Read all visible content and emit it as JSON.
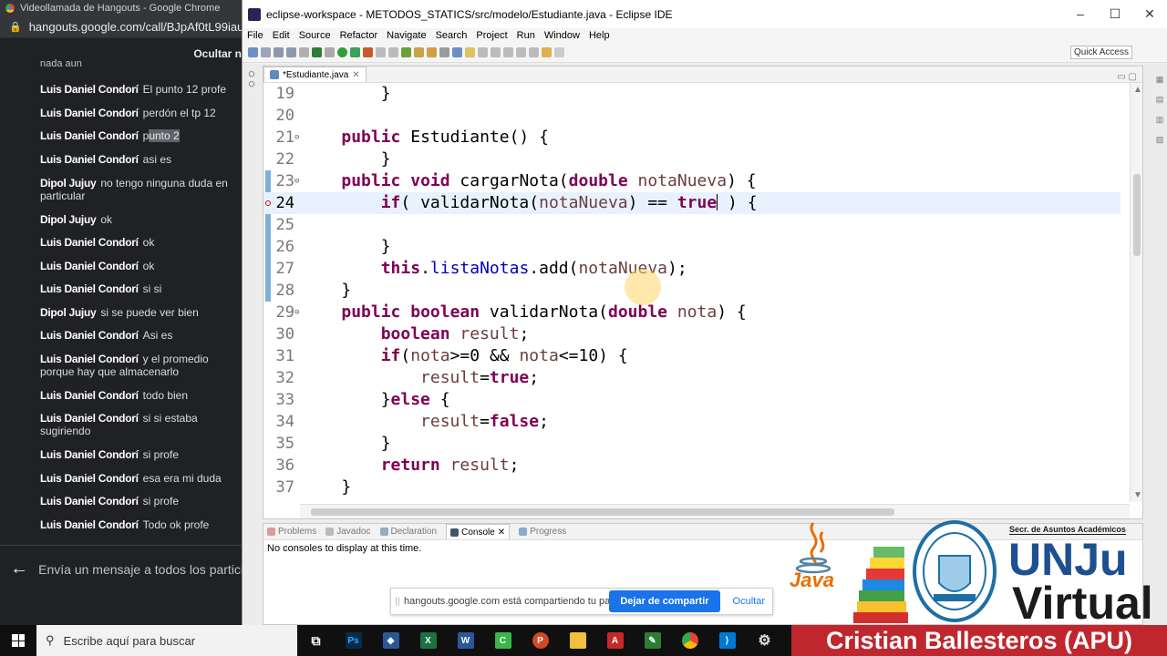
{
  "chrome": {
    "window_title": "Videollamada de Hangouts - Google Chrome",
    "url": "hangouts.google.com/call/BJpAf0tL99iauoPOj"
  },
  "chat": {
    "hide_button": "Ocultar n",
    "cut_text": "nada aun",
    "messages": [
      {
        "author": "Luis Daniel Condorí",
        "text": "El punto 12 profe"
      },
      {
        "author": "Luis Daniel Condorí",
        "text": "perdón el tp 12"
      },
      {
        "author": "Luis Daniel Condorí",
        "text_a": "p",
        "text_hl": "unto 2"
      },
      {
        "author": "Luis Daniel Condorí",
        "text": "asi es"
      },
      {
        "author": "Dipol Jujuy",
        "text": "no tengo ninguna duda en particular"
      },
      {
        "author": "Dipol Jujuy",
        "text": "ok"
      },
      {
        "author": "Luis Daniel Condorí",
        "text": "ok"
      },
      {
        "author": "Luis Daniel Condorí",
        "text": "ok"
      },
      {
        "author": "Luis Daniel Condorí",
        "text": "si si"
      },
      {
        "author": "Dipol Jujuy",
        "text": "si se puede ver bien"
      },
      {
        "author": "Luis Daniel Condorí",
        "text": "Asi es"
      },
      {
        "author": "Luis Daniel Condorí",
        "text": "y el promedio porque hay que almacenarlo"
      },
      {
        "author": "Luis Daniel Condorí",
        "text": "todo bien"
      },
      {
        "author": "Luis Daniel Condorí",
        "text": "si si estaba sugiriendo"
      },
      {
        "author": "Luis Daniel Condorí",
        "text": "si profe"
      },
      {
        "author": "Luis Daniel Condorí",
        "text": "esa era mi duda"
      },
      {
        "author": "Luis Daniel Condorí",
        "text": "si profe"
      },
      {
        "author": "Luis Daniel Condorí",
        "text": "Todo ok profe"
      }
    ],
    "input_placeholder": "Envía un mensaje a todos los particip"
  },
  "eclipse": {
    "title": "eclipse-workspace - METODOS_STATICS/src/modelo/Estudiante.java - Eclipse IDE",
    "menu": [
      "File",
      "Edit",
      "Source",
      "Refactor",
      "Navigate",
      "Search",
      "Project",
      "Run",
      "Window",
      "Help"
    ],
    "quick_access": "Quick Access",
    "editor_tab": "*Estudiante.java",
    "line_numbers": [
      "19",
      "20",
      "21",
      "22",
      "23",
      "24",
      "25",
      "26",
      "27",
      "28",
      "29",
      "30",
      "31",
      "32",
      "33",
      "34",
      "35",
      "36",
      "37"
    ],
    "code": {
      "l19": "    }",
      "l21_kw": "public",
      "l21_rest": " Estudiante() {",
      "l22": "    }",
      "l23_kw1": "public",
      "l23_kw2": "void",
      "l23_mid": " cargarNota(",
      "l23_kw3": "double",
      "l23_var": "notaNueva",
      "l23_end": ") {",
      "l24_a": "if",
      "l24_b": "( validarNota(",
      "l24_var": "notaNueva",
      "l24_c": ") == ",
      "l24_kw": "true",
      "l24_d": " ) {",
      "l26": "}",
      "l27_kw": "this",
      "l27_dot": ".",
      "l27_fld": "listaNotas",
      "l27_b": ".add(",
      "l27_var": "notaNueva",
      "l27_c": ");",
      "l28": "}",
      "l29_kw1": "public",
      "l29_kw2": "boolean",
      "l29_mid": " validarNota(",
      "l29_kw3": "double",
      "l29_var": "nota",
      "l29_end": ") {",
      "l30_kw": "boolean",
      "l30_var": "result",
      "l30_end": ";",
      "l31_kw": "if",
      "l31_a": "(",
      "l31_var1": "nota",
      "l31_b": ">=0 && ",
      "l31_var2": "nota",
      "l31_c": "<=10) {",
      "l32_var": "result",
      "l32_eq": "=",
      "l32_kw": "true",
      "l32_end": ";",
      "l33_a": "}",
      "l33_kw": "else",
      "l33_b": " {",
      "l34_var": "result",
      "l34_eq": "=",
      "l34_kw": "false",
      "l34_end": ";",
      "l35": "}",
      "l36_kw": "return",
      "l36_var": "result",
      "l36_end": ";",
      "l37": "}"
    },
    "console_tabs": [
      "Problems",
      "Javadoc",
      "Declaration",
      "Console",
      "Progress"
    ],
    "console_text": "No consoles to display at this time."
  },
  "share_bar": {
    "message": "hangouts.google.com está compartiendo tu pantalla.",
    "stop_label": "Dejar de compartir",
    "hide_label": "Ocultar"
  },
  "overlay": {
    "java_label": "Java",
    "secretaria": "Secr. de Asuntos Académicos",
    "unju": "UNJu",
    "virtual": "Virtual",
    "presenter": "Cristian Ballesteros (APU)"
  },
  "taskbar": {
    "search_placeholder": "Escribe aquí para buscar",
    "apps": [
      "task-view",
      "photoshop",
      "app-blue",
      "excel",
      "word",
      "camtasia",
      "powerpoint",
      "file-explorer",
      "acrobat",
      "app-green",
      "chrome",
      "vscode",
      "settings"
    ]
  }
}
